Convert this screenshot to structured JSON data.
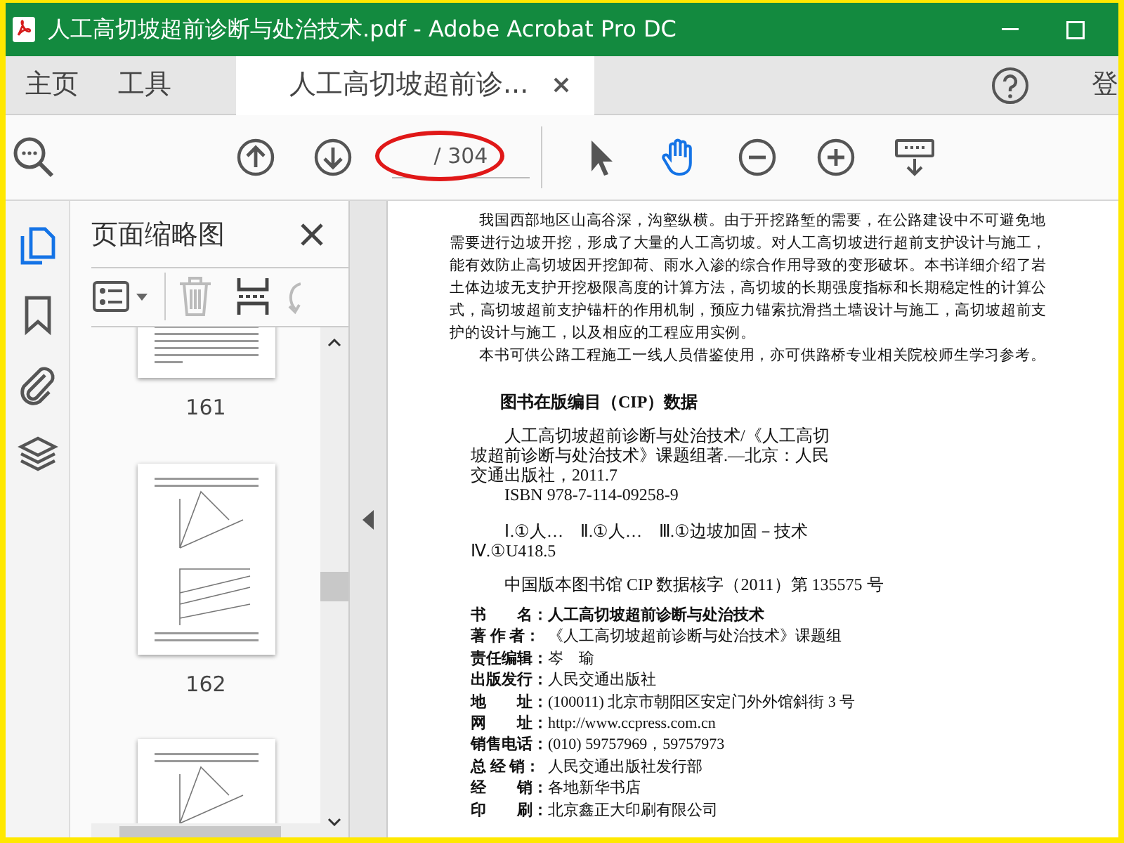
{
  "window": {
    "title": "人工高切坡超前诊断与处治技术.pdf - Adobe Acrobat Pro DC"
  },
  "tabs": [
    {
      "label": "主页",
      "selected": false
    },
    {
      "label": "工具",
      "selected": false
    },
    {
      "label": "人工高切坡超前诊...",
      "selected": true
    }
  ],
  "account_label": "登",
  "toolbar": {
    "page_field": {
      "total": "/ 304"
    },
    "tools": [
      {
        "kind": "select",
        "selected": false
      },
      {
        "kind": "hand",
        "selected": true
      },
      {
        "kind": "zoom-out",
        "selected": false
      },
      {
        "kind": "zoom-in",
        "selected": false
      },
      {
        "kind": "more",
        "selected": false
      }
    ]
  },
  "sidebar": {
    "items": [
      {
        "kind": "pages",
        "selected": true
      },
      {
        "kind": "bookmarks",
        "selected": false
      },
      {
        "kind": "attachments",
        "selected": false
      },
      {
        "kind": "layers",
        "selected": false
      }
    ]
  },
  "thumbnail_panel": {
    "title": "页面缩略图",
    "thumbnails": [
      {
        "kind": "text",
        "label": "161"
      },
      {
        "kind": "chart",
        "label": "162"
      },
      {
        "kind": "chart"
      }
    ]
  },
  "document": {
    "intro_paragraphs": [
      "我国西部地区山高谷深，沟壑纵横。由于开挖路堑的需要，在公路建设中不可避免地需要进行边坡开挖，形成了大量的人工高切坡。对人工高切坡进行超前支护设计与施工，能有效防止高切坡因开挖卸荷、雨水入渗的综合作用导致的变形破坏。本书详细介绍了岩土体边坡无支护开挖极限高度的计算方法，高切坡的长期强度指标和长期稳定性的计算公式，高切坡超前支护锚杆的作用机制，预应力锚索抗滑挡土墙设计与施工，高切坡超前支护的设计与施工，以及相应的工程应用实例。",
      "本书可供公路工程施工一线人员借鉴使用，亦可供路桥专业相关院校师生学习参考。"
    ],
    "cip_heading": "图书在版编目（CIP）数据",
    "cip_paragraphs": [
      "人工高切坡超前诊断与处治技术/《人工高切坡超前诊断与处治技术》课题组著.—北京：人民交通出版社，2011.7",
      "ISBN 978-7-114-09258-9",
      "Ⅰ.①人…　Ⅱ.①人…　Ⅲ.①边坡加固－技术　Ⅳ.①U418.5",
      "中国版本图书馆 CIP 数据核字（2011）第 135575 号"
    ],
    "info_rows": [
      {
        "label": "书　　名：",
        "value": "人工高切坡超前诊断与处治技术"
      },
      {
        "label": "著 作 者：",
        "value": "《人工高切坡超前诊断与处治技术》课题组"
      },
      {
        "label": "责任编辑：",
        "value": "岑　瑜"
      },
      {
        "label": "出版发行：",
        "value": "人民交通出版社"
      },
      {
        "label": "地　　址：",
        "value": "(100011) 北京市朝阳区安定门外外馆斜街 3 号"
      },
      {
        "label": "网　　址：",
        "value": "http://www.ccpress.com.cn"
      },
      {
        "label": "销售电话：",
        "value": "(010) 59757969，59757973"
      },
      {
        "label": "总 经 销：",
        "value": "人民交通出版社发行部"
      },
      {
        "label": "经　　销：",
        "value": "各地新华书店"
      },
      {
        "label": "印　　刷：",
        "value": "北京鑫正大印刷有限公司"
      }
    ]
  }
}
